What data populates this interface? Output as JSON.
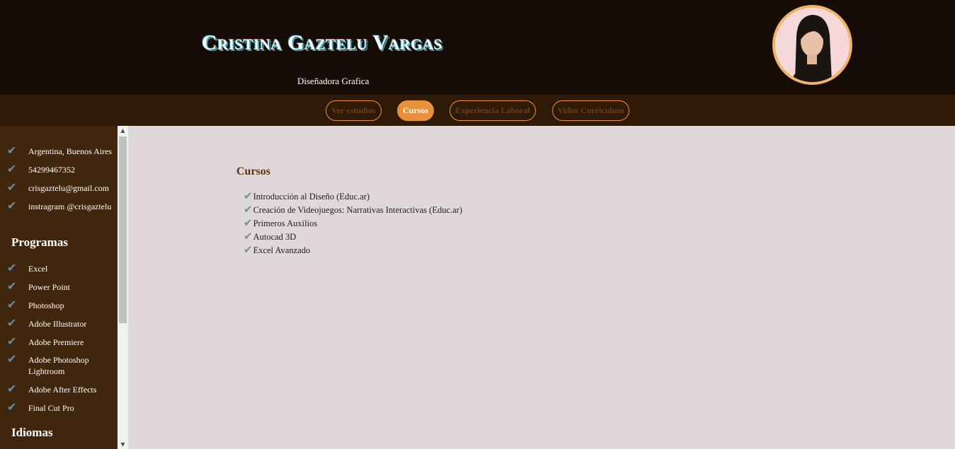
{
  "header": {
    "name": "Cristina Gaztelu Vargas",
    "subtitle": "Diseñadora Grafica"
  },
  "nav": [
    {
      "label": "Ver estudios",
      "active": false
    },
    {
      "label": "Cursos",
      "active": true
    },
    {
      "label": "Experiencia Laboral",
      "active": false
    },
    {
      "label": "Video Curriculum",
      "active": false
    }
  ],
  "sidebar": {
    "contact": [
      "Argentina, Buenos Aires",
      "54299467352",
      "crisgaztelu@gmail.com",
      "instragram @crisgaztelu"
    ],
    "programs_heading": "Programas",
    "programs": [
      "Excel",
      "Power Point",
      "Photoshop",
      "Adobe Illustrator",
      "Adobe Premiere",
      "Adobe Photoshop Lightroom",
      "Adobe After Effects",
      "Final Cut Pro"
    ],
    "languages_heading": "Idiomas"
  },
  "main": {
    "title": "Cursos",
    "courses": [
      "Introducción al Diseño (Educ.ar)",
      "Creación de Videojuegos: Narrativas Interactivas (Educ.ar)",
      "Primeros Auxilios",
      "Autocad 3D",
      "Excel Avanzado"
    ]
  },
  "icons": {
    "check": "check-icon",
    "avatar": "profile-photo"
  },
  "colors": {
    "header_bg": "#170d06",
    "nav_bg": "#2f1a08",
    "sidebar_bg": "#40260d",
    "accent": "#e8913c",
    "content_bg": "#dfd7d8",
    "check": "#6e8ea3"
  }
}
